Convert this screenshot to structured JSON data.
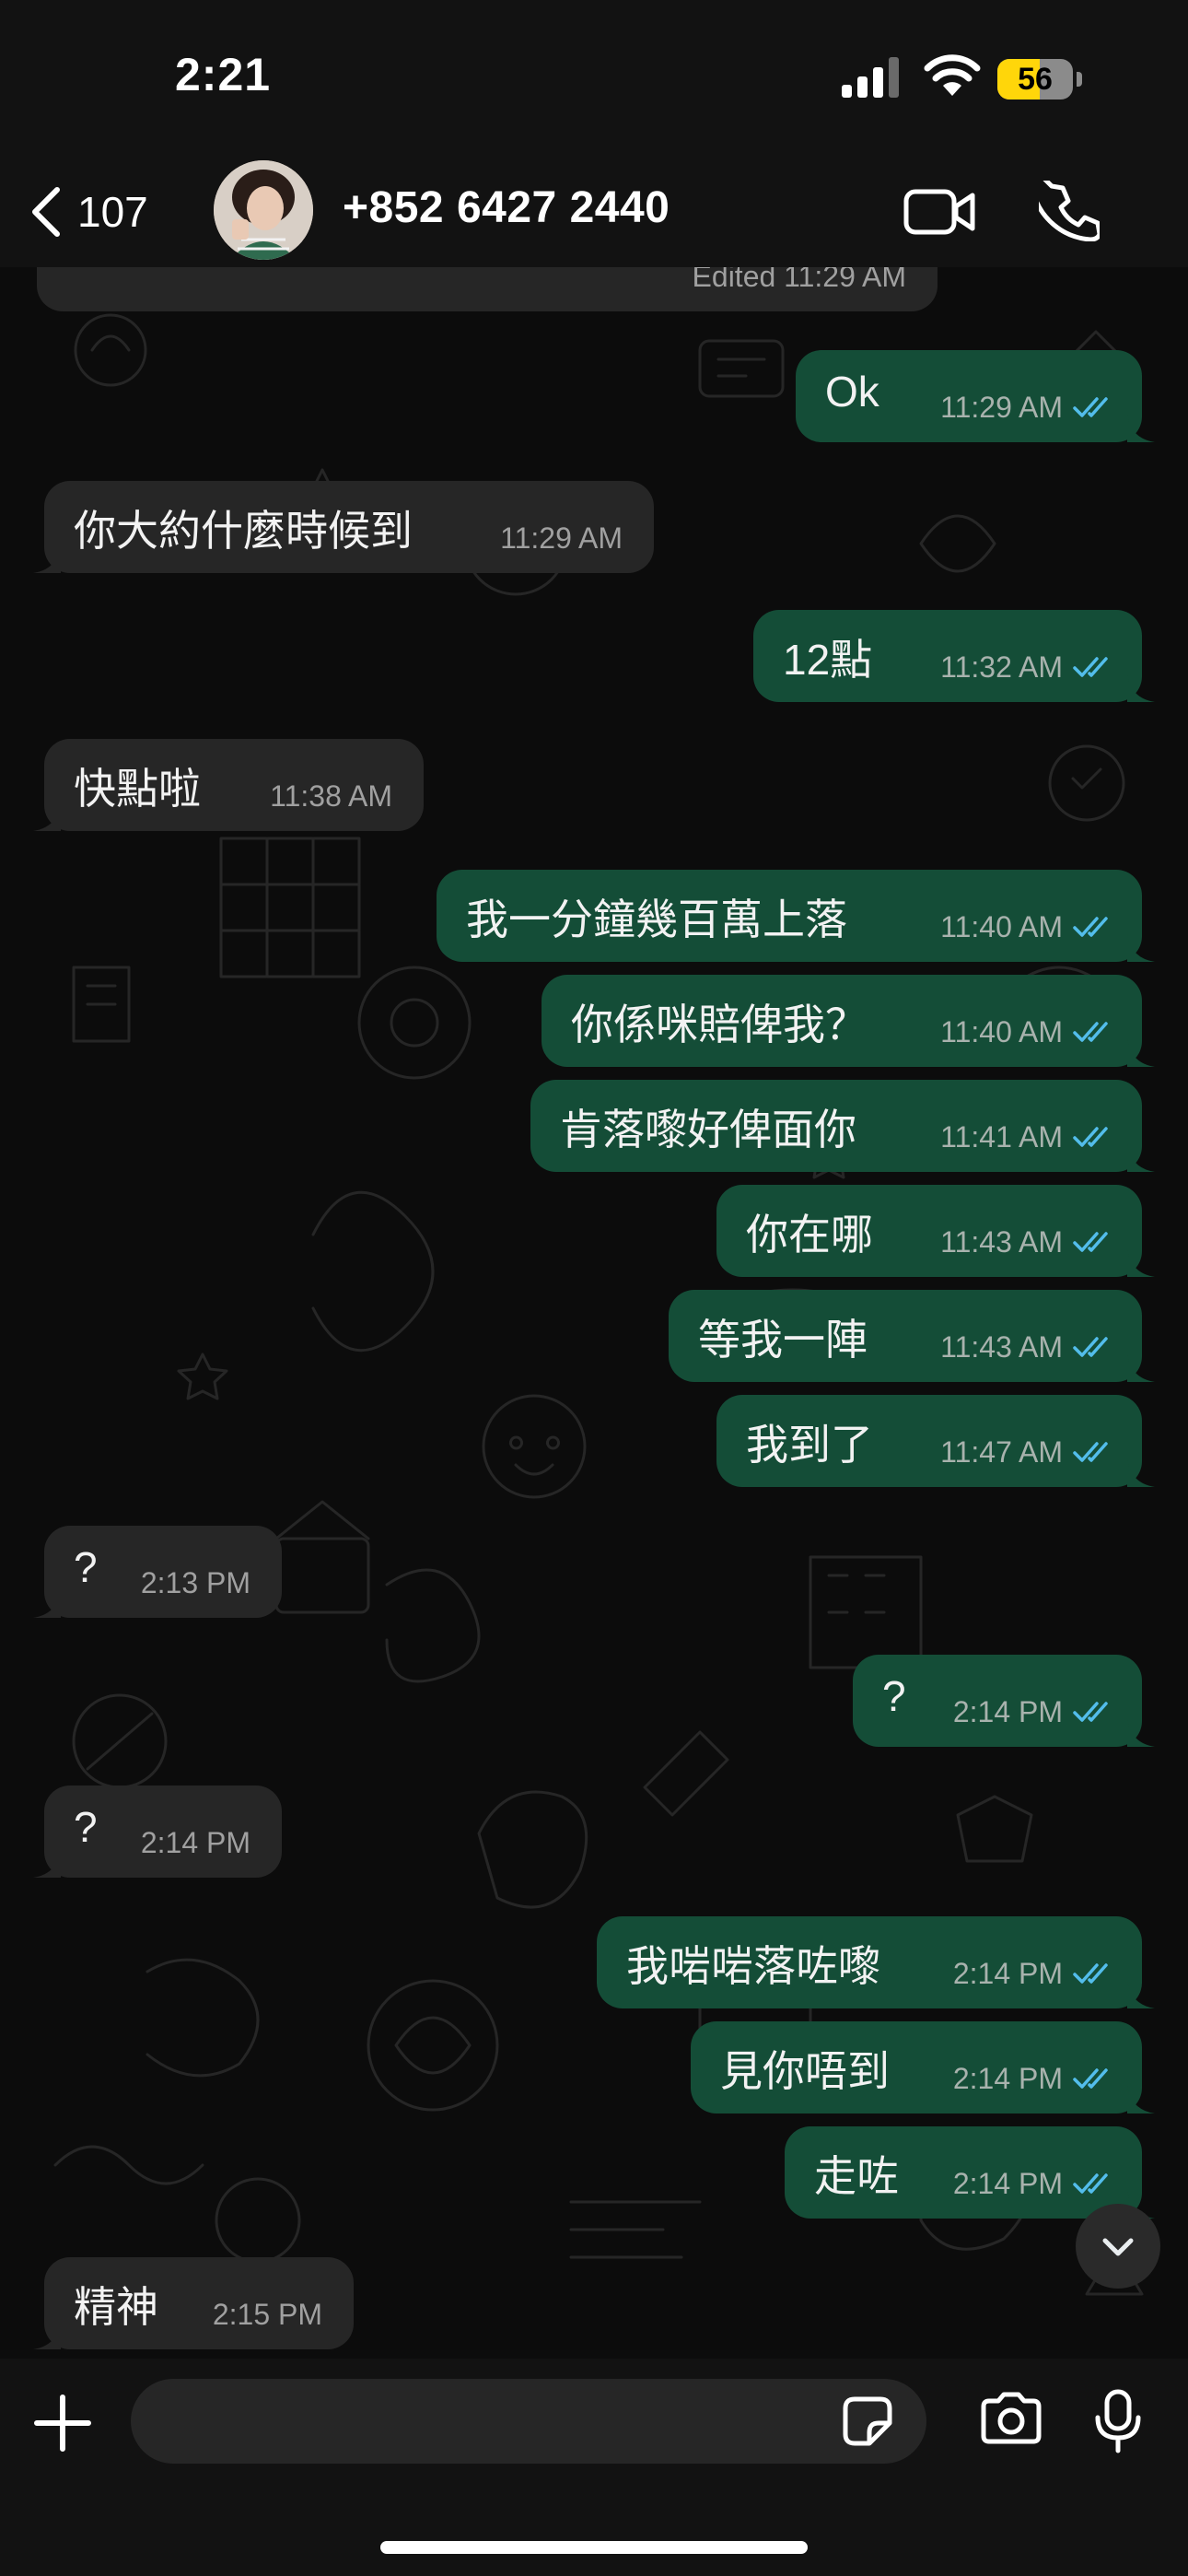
{
  "status_bar": {
    "time": "2:21",
    "battery": "56",
    "battery_level": 0.56
  },
  "header": {
    "back_count": "107",
    "contact": "+852 6427 2440"
  },
  "edited_label": "Edited  11:29 AM",
  "messages": [
    {
      "dir": "out",
      "text": "Ok",
      "time": "11:29 AM",
      "read": true
    },
    {
      "dir": "in",
      "text": "你大約什麼時候到",
      "time": "11:29 AM"
    },
    {
      "dir": "out",
      "text": "12點",
      "time": "11:32 AM",
      "read": true
    },
    {
      "dir": "in",
      "text": "快點啦",
      "time": "11:38 AM"
    },
    {
      "dir": "out",
      "text": "我一分鐘幾百萬上落",
      "time": "11:40 AM",
      "read": true
    },
    {
      "dir": "out",
      "text": "你係咪賠俾我？",
      "time": "11:40 AM",
      "read": true
    },
    {
      "dir": "out",
      "text": "肯落嚟好俾面你",
      "time": "11:41 AM",
      "read": true
    },
    {
      "dir": "out",
      "text": "你在哪",
      "time": "11:43 AM",
      "read": true
    },
    {
      "dir": "out",
      "text": "等我一陣",
      "time": "11:43 AM",
      "read": true
    },
    {
      "dir": "out",
      "text": "我到了",
      "time": "11:47 AM",
      "read": true
    },
    {
      "dir": "in",
      "text": "?",
      "time": "2:13 PM"
    },
    {
      "dir": "out",
      "text": "?",
      "time": "2:14 PM",
      "read": true
    },
    {
      "dir": "in",
      "text": "?",
      "time": "2:14 PM"
    },
    {
      "dir": "out",
      "text": "我啱啱落咗嚟",
      "time": "2:14 PM",
      "read": true
    },
    {
      "dir": "out",
      "text": "見你唔到",
      "time": "2:14 PM",
      "read": true
    },
    {
      "dir": "out",
      "text": "走咗",
      "time": "2:14 PM",
      "read": true
    },
    {
      "dir": "in",
      "text": "精神",
      "time": "2:15 PM"
    }
  ],
  "input": {
    "placeholder": ""
  },
  "icons": [
    "chevron-left-icon",
    "video-call-icon",
    "phone-icon",
    "plus-icon",
    "sticker-icon",
    "camera-icon",
    "microphone-icon",
    "chevron-down-icon",
    "double-check-icon"
  ],
  "colors": {
    "outgoing_bubble": "#144d37",
    "incoming_bubble": "#262626",
    "read_ticks": "#53bdeb",
    "battery": "#ffd60a"
  }
}
